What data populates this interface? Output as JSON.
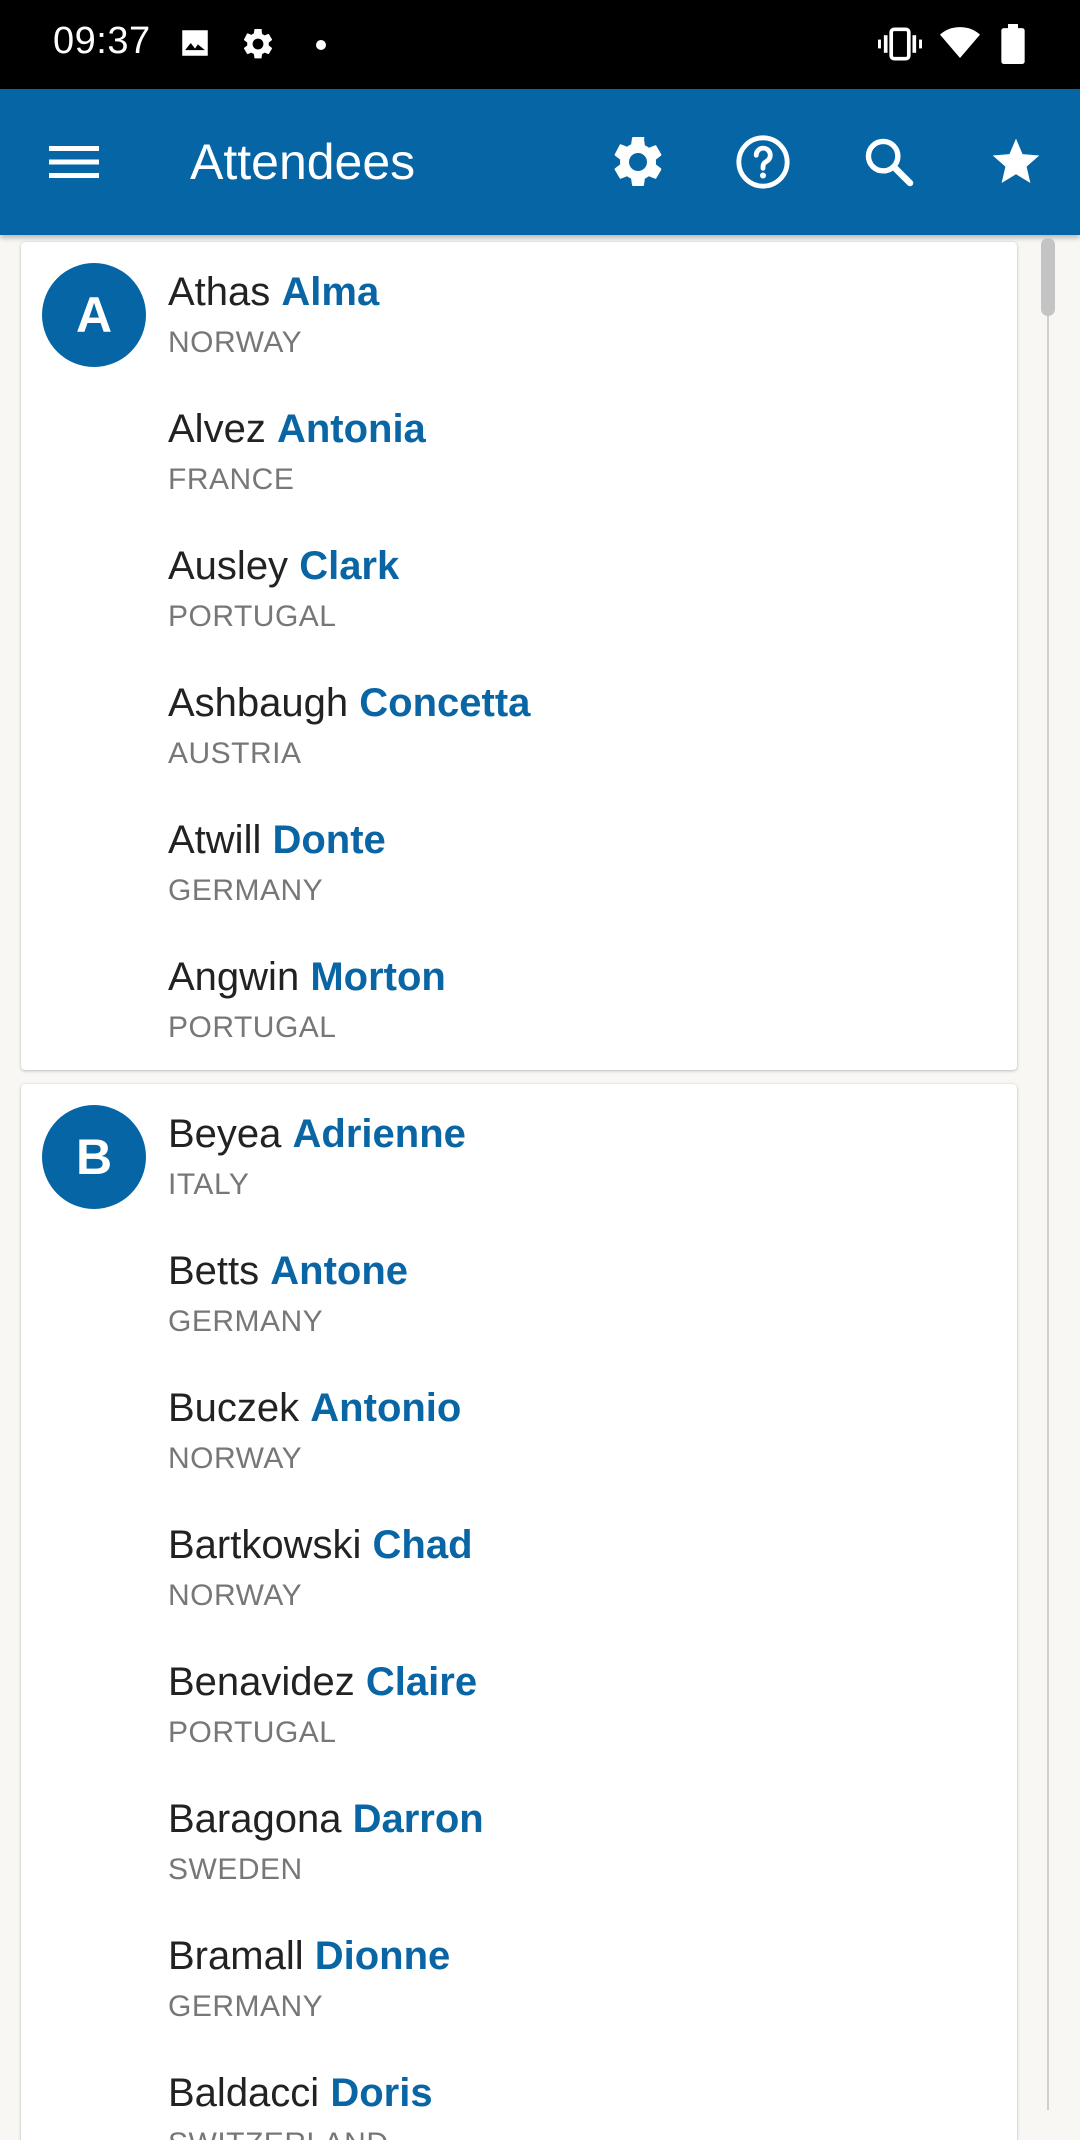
{
  "status_bar": {
    "time": "09:37",
    "left_icons": [
      "image-icon",
      "settings-gear-icon",
      "dot-icon"
    ],
    "right_icons": [
      "vibrate-icon",
      "wifi-icon",
      "battery-icon"
    ]
  },
  "app_bar": {
    "title": "Attendees",
    "background": "#0565a5",
    "actions": [
      "menu-icon",
      "settings-icon",
      "help-icon",
      "search-icon",
      "favorite-star-icon"
    ]
  },
  "sections": [
    {
      "letter": "A",
      "attendees": [
        {
          "last": "Athas",
          "first": "Alma",
          "country": "NORWAY"
        },
        {
          "last": "Alvez",
          "first": "Antonia",
          "country": "FRANCE"
        },
        {
          "last": "Ausley",
          "first": "Clark",
          "country": "PORTUGAL"
        },
        {
          "last": "Ashbaugh",
          "first": "Concetta",
          "country": "AUSTRIA"
        },
        {
          "last": "Atwill",
          "first": "Donte",
          "country": "GERMANY"
        },
        {
          "last": "Angwin",
          "first": "Morton",
          "country": "PORTUGAL"
        }
      ]
    },
    {
      "letter": "B",
      "attendees": [
        {
          "last": "Beyea",
          "first": "Adrienne",
          "country": "ITALY"
        },
        {
          "last": "Betts",
          "first": "Antone",
          "country": "GERMANY"
        },
        {
          "last": "Buczek",
          "first": "Antonio",
          "country": "NORWAY"
        },
        {
          "last": "Bartkowski",
          "first": "Chad",
          "country": "NORWAY"
        },
        {
          "last": "Benavidez",
          "first": "Claire",
          "country": "PORTUGAL"
        },
        {
          "last": "Baragona",
          "first": "Darron",
          "country": "SWEDEN"
        },
        {
          "last": "Bramall",
          "first": "Dionne",
          "country": "GERMANY"
        },
        {
          "last": "Baldacci",
          "first": "Doris",
          "country": "SWITZERLAND"
        }
      ]
    }
  ]
}
